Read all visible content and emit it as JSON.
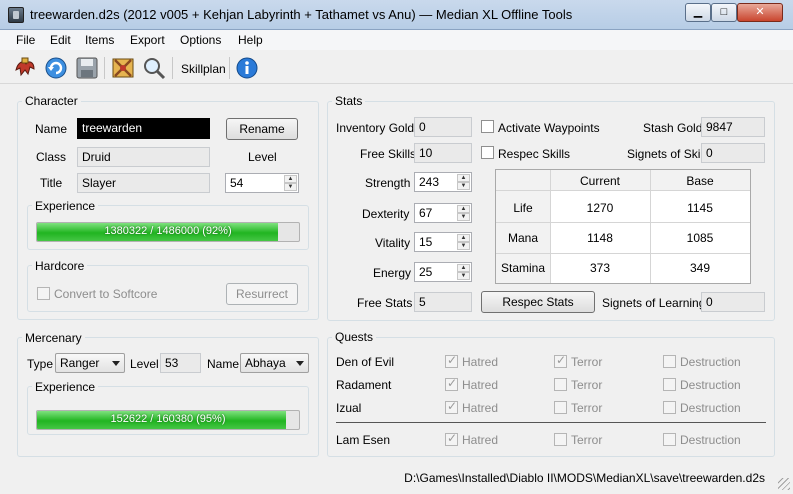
{
  "window": {
    "title": "treewarden.d2s (2012 v005 + Kehjan Labyrinth + Tathamet vs Anu) — Median XL Offline Tools",
    "minimize": "▁",
    "maximize": "□",
    "close": "✕"
  },
  "menu": [
    "File",
    "Edit",
    "Items",
    "Export",
    "Options",
    "Help"
  ],
  "toolbar": {
    "skillplan_label": "Skillplan"
  },
  "character": {
    "group_title": "Character",
    "name_label": "Name",
    "name_value": "treewarden",
    "rename_button": "Rename",
    "class_label": "Class",
    "class_value": "Druid",
    "level_label": "Level",
    "level_value": "54",
    "title_label": "Title",
    "title_value": "Slayer",
    "experience_title": "Experience",
    "experience_text": "1380322 / 1486000 (92%)",
    "experience_fraction": 0.92,
    "hardcore_title": "Hardcore",
    "convert_label": "Convert to Softcore",
    "resurrect_button": "Resurrect"
  },
  "mercenary": {
    "group_title": "Mercenary",
    "type_label": "Type",
    "type_value": "Ranger",
    "level_label": "Level",
    "level_value": "53",
    "name_label": "Name",
    "name_value": "Abhaya",
    "experience_title": "Experience",
    "experience_text": "152622 / 160380 (95%)",
    "experience_fraction": 0.95
  },
  "stats": {
    "group_title": "Stats",
    "inventory_gold_label": "Inventory Gold",
    "inventory_gold_value": "0",
    "activate_waypoints_label": "Activate Waypoints",
    "stash_gold_label": "Stash Gold",
    "stash_gold_value": "9847",
    "free_skills_label": "Free Skills",
    "free_skills_value": "10",
    "respec_skills_label": "Respec Skills",
    "signets_skill_label": "Signets of Skill",
    "signets_skill_value": "0",
    "strength_label": "Strength",
    "strength_value": "243",
    "dexterity_label": "Dexterity",
    "dexterity_value": "67",
    "vitality_label": "Vitality",
    "vitality_value": "15",
    "energy_label": "Energy",
    "energy_value": "25",
    "free_stats_label": "Free Stats",
    "free_stats_value": "5",
    "respec_stats_button": "Respec Stats",
    "signets_learning_label": "Signets of Learning",
    "signets_learning_value": "0",
    "table": {
      "headers": [
        "Current",
        "Base"
      ],
      "rows": [
        {
          "label": "Life",
          "current": "1270",
          "base": "1145"
        },
        {
          "label": "Mana",
          "current": "1148",
          "base": "1085"
        },
        {
          "label": "Stamina",
          "current": "373",
          "base": "349"
        }
      ]
    }
  },
  "quests": {
    "group_title": "Quests",
    "columns": [
      "Hatred",
      "Terror",
      "Destruction"
    ],
    "rows": [
      {
        "name": "Den of Evil",
        "hatred": true,
        "terror": true,
        "destruction": false
      },
      {
        "name": "Radament",
        "hatred": true,
        "terror": false,
        "destruction": false
      },
      {
        "name": "Izual",
        "hatred": true,
        "terror": false,
        "destruction": false
      },
      {
        "name": "Lam Esen",
        "hatred": true,
        "terror": false,
        "destruction": false
      }
    ]
  },
  "status_bar": {
    "path": "D:\\Games\\Installed\\Diablo II\\MODS\\MedianXL\\save\\treewarden.d2s"
  }
}
